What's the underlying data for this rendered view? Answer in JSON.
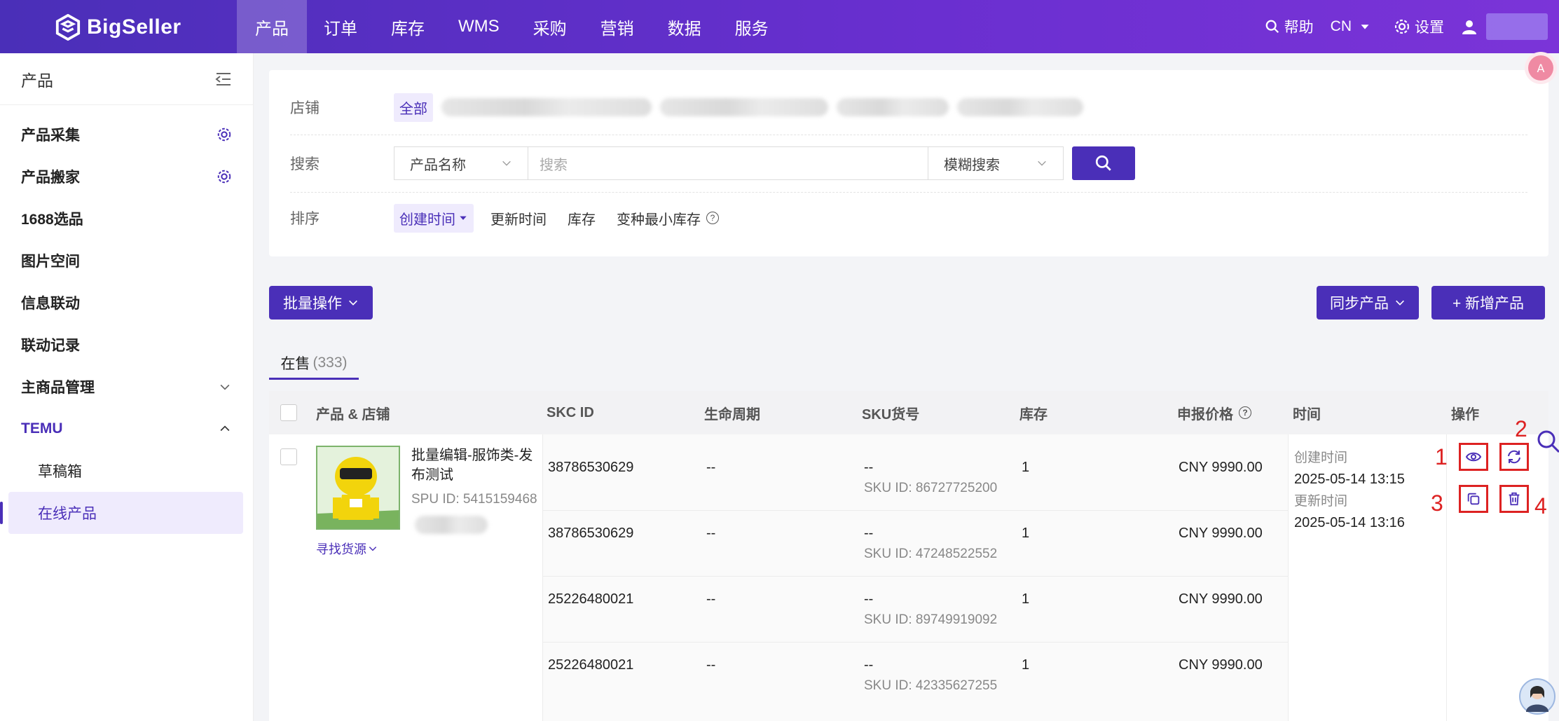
{
  "brand": {
    "name": "BigSeller"
  },
  "nav": [
    "产品",
    "订单",
    "库存",
    "WMS",
    "采购",
    "营销",
    "数据",
    "服务"
  ],
  "top_right": {
    "help": "帮助",
    "lang": "CN",
    "settings": "设置"
  },
  "sidebar": {
    "title": "产品",
    "items": [
      {
        "label": "产品采集",
        "icon": "gear-icon"
      },
      {
        "label": "产品搬家",
        "icon": "gear-icon"
      },
      {
        "label": "1688选品"
      },
      {
        "label": "图片空间"
      },
      {
        "label": "信息联动"
      },
      {
        "label": "联动记录"
      },
      {
        "label": "主商品管理",
        "icon": "chevron-down-icon"
      },
      {
        "label": "TEMU",
        "icon": "chevron-up-icon"
      }
    ],
    "sub_items": [
      "草稿箱",
      "在线产品"
    ]
  },
  "filter": {
    "store_label": "店铺",
    "store_all": "全部",
    "search_label": "搜索",
    "search_field": "产品名称",
    "search_placeholder": "搜索",
    "search_mode": "模糊搜索",
    "sort_label": "排序",
    "sort_options": [
      "创建时间",
      "更新时间",
      "库存",
      "变种最小库存"
    ]
  },
  "toolbar": {
    "bulk": "批量操作",
    "sync": "同步产品",
    "add": "+ 新增产品"
  },
  "tabs": [
    {
      "label": "在售",
      "count": "(333)"
    }
  ],
  "table": {
    "headers": [
      "产品 & 店铺",
      "SKC ID",
      "生命周期",
      "SKU货号",
      "库存",
      "申报价格",
      "时间",
      "操作"
    ],
    "product": {
      "title_line1": "批量编辑-服饰类-发",
      "title_line2": "布测试",
      "spu": "SPU ID: 5415159468",
      "find_source": "寻找货源"
    },
    "rows": [
      {
        "skc": "38786530629",
        "lifecycle": "--",
        "sku_code": "--",
        "sku_id": "SKU ID: 86727725200",
        "stock": "1",
        "price": "CNY 9990.00"
      },
      {
        "skc": "38786530629",
        "lifecycle": "--",
        "sku_code": "--",
        "sku_id": "SKU ID: 47248522552",
        "stock": "1",
        "price": "CNY 9990.00"
      },
      {
        "skc": "25226480021",
        "lifecycle": "--",
        "sku_code": "--",
        "sku_id": "SKU ID: 89749919092",
        "stock": "1",
        "price": "CNY 9990.00"
      },
      {
        "skc": "25226480021",
        "lifecycle": "--",
        "sku_code": "--",
        "sku_id": "SKU ID: 42335627255",
        "stock": "1",
        "price": "CNY 9990.00"
      }
    ],
    "time": {
      "created_label": "创建时间",
      "created": "2025-05-14 13:15",
      "updated_label": "更新时间",
      "updated": "2025-05-14 13:16"
    },
    "action_markers": [
      "1",
      "2",
      "3",
      "4"
    ]
  },
  "colors": {
    "brand": "#4a2fb8",
    "annotation": "#dd2222"
  }
}
